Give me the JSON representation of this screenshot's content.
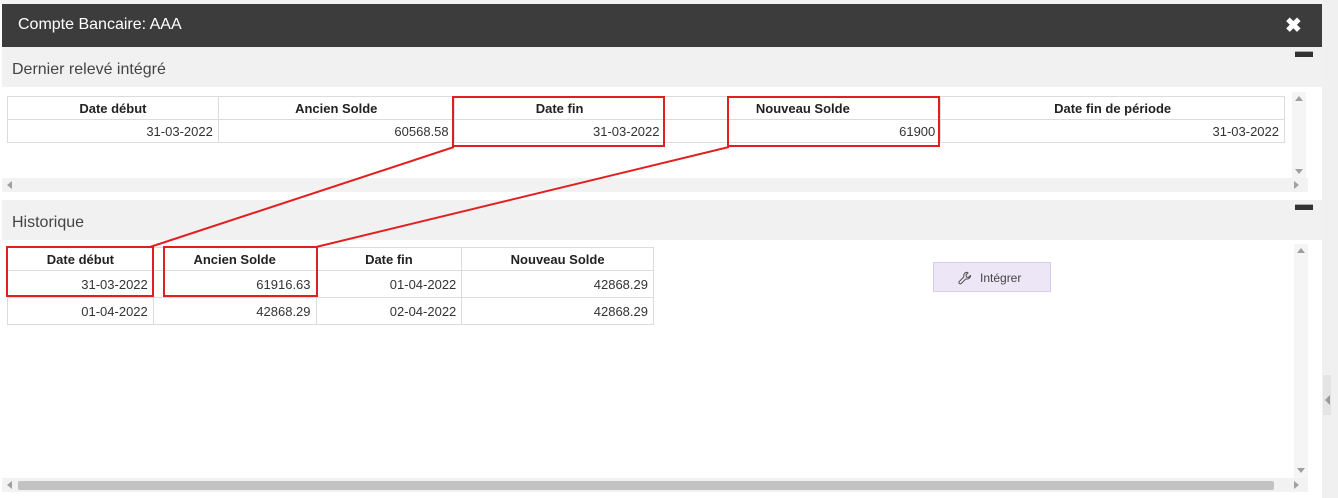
{
  "dialog": {
    "title": "Compte Bancaire: AAA",
    "close_symbol": "✖"
  },
  "last_statement": {
    "heading": "Dernier relevé intégré",
    "collapse_symbol": "▬",
    "columns": [
      "Date début",
      "Ancien Solde",
      "Date fin",
      "Nouveau Solde",
      "Date fin de période"
    ],
    "rows": [
      [
        "31-03-2022",
        "60568.58",
        "31-03-2022",
        "61900",
        "31-03-2022"
      ]
    ]
  },
  "history": {
    "heading": "Historique",
    "collapse_symbol": "▬",
    "columns": [
      "Date début",
      "Ancien Solde",
      "Date fin",
      "Nouveau Solde"
    ],
    "rows": [
      [
        "31-03-2022",
        "61916.63",
        "01-04-2022",
        "42868.29"
      ],
      [
        "01-04-2022",
        "42868.29",
        "02-04-2022",
        "42868.29"
      ]
    ],
    "integrate_button": {
      "label": "Intégrer",
      "icon": "wrench-icon"
    }
  },
  "colors": {
    "titlebar": "#3c3c3c",
    "highlight": "#e02020",
    "button_bg": "#ece6f6"
  }
}
